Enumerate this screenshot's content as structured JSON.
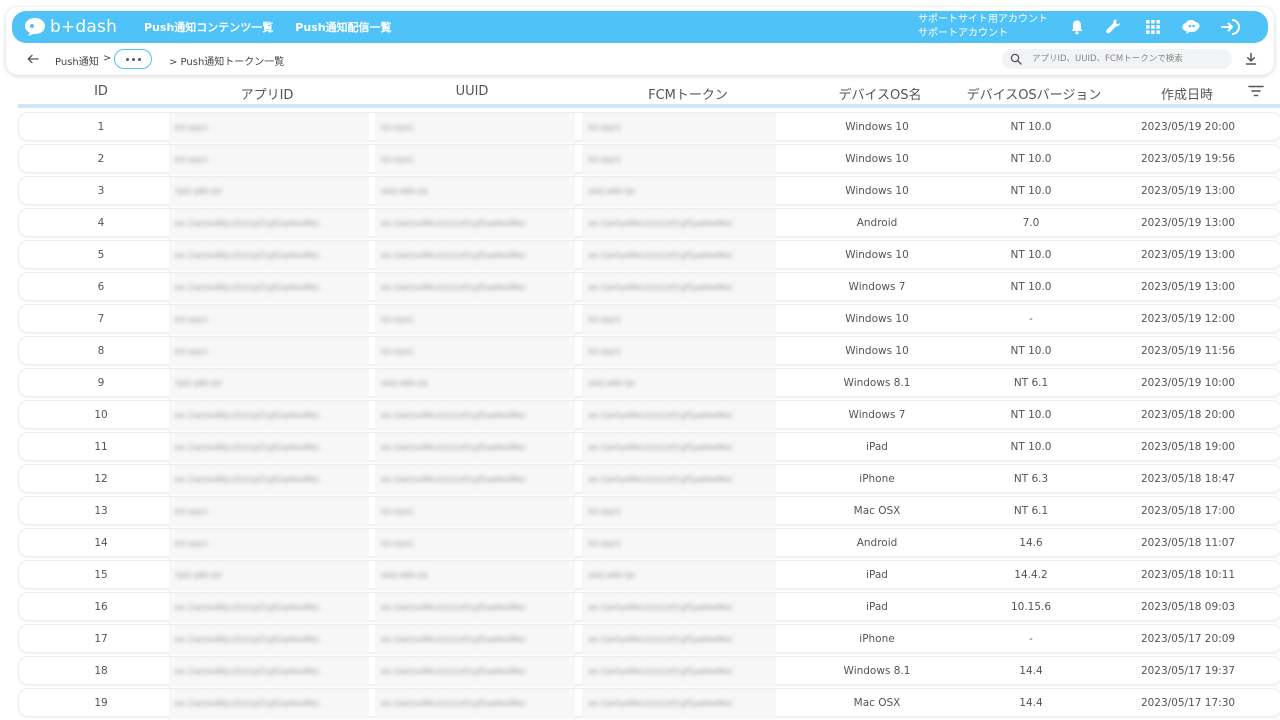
{
  "app": {
    "logo_text": "b+dash"
  },
  "nav": {
    "link1": "Push通知コンテンツ一覧",
    "link2": "Push通知配信一覧"
  },
  "account": {
    "line1": "サポートサイト用アカウント",
    "line2": "サポートアカウント"
  },
  "icons": {
    "bell": "bell-icon",
    "wrench": "wrench-icon",
    "grid": "apps-grid-icon",
    "brain": "ai-brain-icon",
    "logout": "logout-icon",
    "back": "back-arrow-icon",
    "search": "search-icon",
    "download": "download-icon",
    "filter": "filter-icon"
  },
  "breadcrumb": {
    "root": "Push通知",
    "sep": ">",
    "current": "> Push通知トークン一覧"
  },
  "search": {
    "placeholder": "アプリID、UUID、FCMトークンで検索"
  },
  "colors": {
    "accent": "#4fc3f7"
  },
  "table": {
    "columns": [
      "ID",
      "アプリID",
      "UUID",
      "FCMトークン",
      "デバイスOS名",
      "デバイスOSバージョン",
      "作成日時"
    ],
    "rows": [
      {
        "id": "1",
        "blurred": "bd-app1",
        "os": "Windows 10",
        "ver": "NT 10.0",
        "created": "2023/05/19 20:00"
      },
      {
        "id": "2",
        "blurred": "bd-app1",
        "os": "Windows 10",
        "ver": "NT 10.0",
        "created": "2023/05/19 19:56"
      },
      {
        "id": "3",
        "blurred": "ddd-d89-dd",
        "os": "Windows 10",
        "ver": "NT 10.0",
        "created": "2023/05/19 13:00"
      },
      {
        "id": "4",
        "blurred": "ee-2ae5ed8bcd2e1e01gf5ae6ed8bc",
        "os": "Android",
        "ver": "7.0",
        "created": "2023/05/19 13:00"
      },
      {
        "id": "5",
        "blurred": "ee-2ae5ed8bcd2e1e01gf5ae6ed8bc",
        "os": "Windows 10",
        "ver": "NT 10.0",
        "created": "2023/05/19 13:00"
      },
      {
        "id": "6",
        "blurred": "ee-2ae5ed8bcd2e1e01gf5ae6ed8bc",
        "os": "Windows 7",
        "ver": "NT 10.0",
        "created": "2023/05/19 13:00"
      },
      {
        "id": "7",
        "blurred": "bd-app1",
        "os": "Windows 10",
        "ver": "-",
        "created": "2023/05/19 12:00"
      },
      {
        "id": "8",
        "blurred": "bd-app1",
        "os": "Windows 10",
        "ver": "NT 10.0",
        "created": "2023/05/19 11:56"
      },
      {
        "id": "9",
        "blurred": "ddd-d89-dd",
        "os": "Windows 8.1",
        "ver": "NT 6.1",
        "created": "2023/05/19 10:00"
      },
      {
        "id": "10",
        "blurred": "ee-2ae5ed8bcd2e1e01gf5ae6ed8bc",
        "os": "Windows 7",
        "ver": "NT 10.0",
        "created": "2023/05/18 20:00"
      },
      {
        "id": "11",
        "blurred": "ee-2ae5ed8bcd2e1e01gf5ae6ed8bc",
        "os": "iPad",
        "ver": "NT 10.0",
        "created": "2023/05/18 19:00"
      },
      {
        "id": "12",
        "blurred": "ee-2ae5ed8bcd2e1e01gf5ae6ed8bc",
        "os": "iPhone",
        "ver": "NT 6.3",
        "created": "2023/05/18 18:47"
      },
      {
        "id": "13",
        "blurred": "bd-app1",
        "os": "Mac OSX",
        "ver": "NT 6.1",
        "created": "2023/05/18 17:00"
      },
      {
        "id": "14",
        "blurred": "bd-app1",
        "os": "Android",
        "ver": "14.6",
        "created": "2023/05/18 11:07"
      },
      {
        "id": "15",
        "blurred": "ddd-d89-dd",
        "os": "iPad",
        "ver": "14.4.2",
        "created": "2023/05/18 10:11"
      },
      {
        "id": "16",
        "blurred": "ee-2ae5ed8bcd2e1e01gf5ae6ed8bc",
        "os": "iPad",
        "ver": "10.15.6",
        "created": "2023/05/18 09:03"
      },
      {
        "id": "17",
        "blurred": "ee-2ae5ed8bcd2e1e01gf5ae6ed8bc",
        "os": "iPhone",
        "ver": "-",
        "created": "2023/05/17 20:09"
      },
      {
        "id": "18",
        "blurred": "ee-2ae5ed8bcd2e1e01gf5ae6ed8bc",
        "os": "Windows 8.1",
        "ver": "14.4",
        "created": "2023/05/17 19:37"
      },
      {
        "id": "19",
        "blurred": "ee-2ae5ed8bcd2e1e01gf5ae6ed8bc",
        "os": "Mac OSX",
        "ver": "14.4",
        "created": "2023/05/17 17:30"
      }
    ]
  }
}
